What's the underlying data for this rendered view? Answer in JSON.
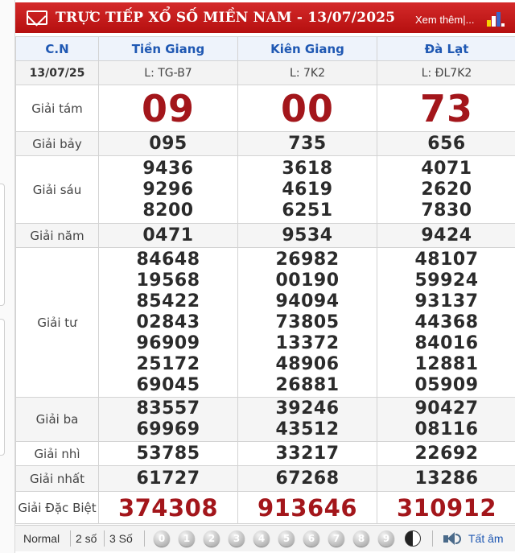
{
  "header": {
    "title": "TRỰC TIẾP XỔ SỐ MIỀN NAM - 13/07/2025",
    "more_link": "Xem thêm|..."
  },
  "table": {
    "day_label": "C.N",
    "date": "13/07/25",
    "provinces": [
      {
        "name": "Tiền Giang",
        "code": "L: TG-B7"
      },
      {
        "name": "Kiên Giang",
        "code": "L: 7K2"
      },
      {
        "name": "Đà Lạt",
        "code": "L: ĐL7K2"
      }
    ],
    "prizes": [
      {
        "label": "Giải tám",
        "kind": "big",
        "values": [
          [
            "09"
          ],
          [
            "00"
          ],
          [
            "73"
          ]
        ]
      },
      {
        "label": "Giải bảy",
        "kind": "n",
        "values": [
          [
            "095"
          ],
          [
            "735"
          ],
          [
            "656"
          ]
        ]
      },
      {
        "label": "Giải sáu",
        "kind": "n",
        "values": [
          [
            "9436",
            "9296",
            "8200"
          ],
          [
            "3618",
            "4619",
            "6251"
          ],
          [
            "4071",
            "2620",
            "7830"
          ]
        ]
      },
      {
        "label": "Giải năm",
        "kind": "n",
        "values": [
          [
            "0471"
          ],
          [
            "9534"
          ],
          [
            "9424"
          ]
        ]
      },
      {
        "label": "Giải tư",
        "kind": "n",
        "values": [
          [
            "84648",
            "19568",
            "85422",
            "02843",
            "96909",
            "25172",
            "69045"
          ],
          [
            "26982",
            "00190",
            "94094",
            "73805",
            "13372",
            "48906",
            "26881"
          ],
          [
            "48107",
            "59924",
            "93137",
            "44368",
            "84016",
            "12881",
            "05909"
          ]
        ]
      },
      {
        "label": "Giải ba",
        "kind": "n",
        "values": [
          [
            "83557",
            "69969"
          ],
          [
            "39246",
            "43512"
          ],
          [
            "90427",
            "08116"
          ]
        ]
      },
      {
        "label": "Giải nhì",
        "kind": "n",
        "values": [
          [
            "53785"
          ],
          [
            "33217"
          ],
          [
            "22692"
          ]
        ]
      },
      {
        "label": "Giải nhất",
        "kind": "n",
        "values": [
          [
            "61727"
          ],
          [
            "67268"
          ],
          [
            "13286"
          ]
        ]
      },
      {
        "label": "Giải Đặc Biệt",
        "kind": "db",
        "values": [
          [
            "374308"
          ],
          [
            "913646"
          ],
          [
            "310912"
          ]
        ]
      }
    ]
  },
  "toolbar": {
    "modes": [
      "Normal",
      "2 số",
      "3 Số"
    ],
    "digits": [
      "0",
      "1",
      "2",
      "3",
      "4",
      "5",
      "6",
      "7",
      "8",
      "9"
    ],
    "read_all": "Tất âm"
  },
  "colors": {
    "header_red": "#c41a1a",
    "province_blue": "#1f58b3",
    "prize_red": "#a3161b"
  },
  "icons": {
    "header_left": "mail-icon",
    "header_right": "bar-chart-icon",
    "toolbar_sound": "speaker-icon",
    "toolbar_toggle": "yin-yang-icon"
  }
}
